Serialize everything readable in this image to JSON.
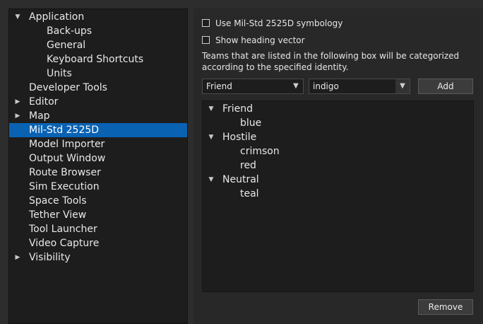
{
  "sidebar": {
    "items": [
      {
        "label": "Application",
        "expanded": true,
        "has_children": true,
        "indent": 1,
        "selected": false
      },
      {
        "label": "Back-ups",
        "has_children": false,
        "indent": 2,
        "selected": false
      },
      {
        "label": "General",
        "has_children": false,
        "indent": 2,
        "selected": false
      },
      {
        "label": "Keyboard Shortcuts",
        "has_children": false,
        "indent": 2,
        "selected": false
      },
      {
        "label": "Units",
        "has_children": false,
        "indent": 2,
        "selected": false
      },
      {
        "label": "Developer Tools",
        "has_children": false,
        "indent": 1,
        "selected": false
      },
      {
        "label": "Editor",
        "expanded": false,
        "has_children": true,
        "indent": 1,
        "selected": false
      },
      {
        "label": "Map",
        "expanded": false,
        "has_children": true,
        "indent": 1,
        "selected": false
      },
      {
        "label": "Mil-Std 2525D",
        "has_children": false,
        "indent": 1,
        "selected": true
      },
      {
        "label": "Model Importer",
        "has_children": false,
        "indent": 1,
        "selected": false
      },
      {
        "label": "Output Window",
        "has_children": false,
        "indent": 1,
        "selected": false
      },
      {
        "label": "Route Browser",
        "has_children": false,
        "indent": 1,
        "selected": false
      },
      {
        "label": "Sim Execution",
        "has_children": false,
        "indent": 1,
        "selected": false
      },
      {
        "label": "Space Tools",
        "has_children": false,
        "indent": 1,
        "selected": false
      },
      {
        "label": "Tether View",
        "has_children": false,
        "indent": 1,
        "selected": false
      },
      {
        "label": "Tool Launcher",
        "has_children": false,
        "indent": 1,
        "selected": false
      },
      {
        "label": "Video Capture",
        "has_children": false,
        "indent": 1,
        "selected": false
      },
      {
        "label": "Visibility",
        "expanded": false,
        "has_children": true,
        "indent": 1,
        "selected": false
      }
    ]
  },
  "settings": {
    "use_symbology_label": "Use Mil-Std 2525D symbology",
    "use_symbology_checked": false,
    "show_heading_label": "Show heading vector",
    "show_heading_checked": false,
    "description_line1": "Teams that are listed in the following box will be categorized",
    "description_line2": "according to the specified identity.",
    "identity_select": "Friend",
    "team_input": "indigo",
    "add_label": "Add",
    "remove_label": "Remove"
  },
  "team_list": {
    "groups": [
      {
        "identity": "Friend",
        "teams": [
          "blue"
        ]
      },
      {
        "identity": "Hostile",
        "teams": [
          "crimson",
          "red"
        ]
      },
      {
        "identity": "Neutral",
        "teams": [
          "teal"
        ]
      }
    ]
  },
  "colors": {
    "selection": "#0a62b3",
    "panel_bg": "#1d1d1d",
    "window_bg": "#2d2d2d"
  }
}
